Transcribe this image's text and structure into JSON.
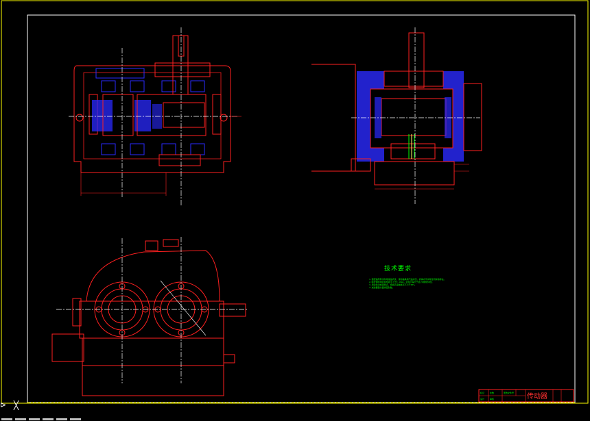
{
  "drawing": {
    "title_block_name": "传动器",
    "tech_notes_title": "技术要求",
    "tech_notes_lines": [
      "1.装配前所有零件用煤油清洗，滚动轴承用汽油清洗，机体内不许有任何杂物存在。",
      "2.啮合侧隙用铅丝检验不小于0.16mm，铅丝不得大于最小侧隙的4倍。",
      "3.用涂色法检验斑点，按齿高接触斑点不小于40%。",
      "4.减速器剖分面涂密封胶。"
    ],
    "title_block_cells": [
      "标记",
      "处数",
      "更改文件号",
      "设计",
      "审核"
    ]
  },
  "colors": {
    "frame": "#ffff00",
    "outline": "#ff2020",
    "part": "#2a2aff",
    "center": "#ffffff",
    "text": "#00ff00",
    "shaft": "#ffff66"
  },
  "icons": {
    "command": "arrow-icon",
    "ucs": "ucs-axis-icon"
  }
}
